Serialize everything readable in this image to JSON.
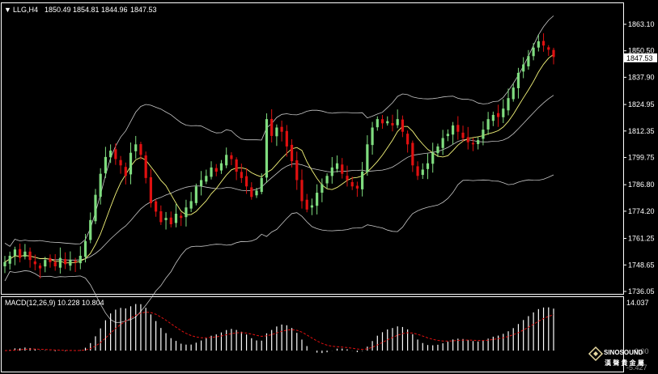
{
  "window": {
    "header_arrow": "▼",
    "symbol_label": "LLG,H4",
    "ohlc": [
      "1850.49",
      "1854.81",
      "1844.96",
      "1847.53"
    ]
  },
  "colors": {
    "background": "#000000",
    "bull_candle": "#7fdc7f",
    "bear_candle": "#e01010",
    "bollinger_band": "#c8c8c8",
    "moving_average": "#f5f57a",
    "macd_histogram": "#ffffff",
    "macd_signal": "#e01010",
    "frame": "#ffffff",
    "current_price_box": "#ffffff"
  },
  "price_axis": {
    "ticks": [
      "1863.10",
      "1850.50",
      "1837.90",
      "1824.95",
      "1812.35",
      "1799.75",
      "1786.80",
      "1774.20",
      "1761.25",
      "1748.65",
      "1736.05"
    ],
    "current_price": "1847.53"
  },
  "macd": {
    "label": "MACD(12,26,9) 10.228 10.804",
    "axis_max": "14.037",
    "axis_zero": "0.00",
    "axis_min": "-5.427"
  },
  "logo": {
    "name": "SINOSOUND",
    "subtitle": "漢 聲 貴 金 屬"
  },
  "chart_data": {
    "type": "candlestick",
    "title": "LLG,H4",
    "y_range": [
      1736.05,
      1866.0
    ],
    "ohlc_last": {
      "open": 1850.49,
      "high": 1854.81,
      "low": 1844.96,
      "close": 1847.53
    },
    "indicators": [
      "Bollinger Bands",
      "Moving Average",
      "MACD(12,26,9)"
    ],
    "macd": {
      "main": 10.228,
      "signal": 10.804,
      "range": [
        -5.427,
        14.037
      ]
    },
    "closes": [
      1750,
      1753,
      1756,
      1752,
      1755,
      1751,
      1749,
      1747,
      1751,
      1750,
      1748,
      1752,
      1749,
      1751,
      1750,
      1753,
      1760,
      1770,
      1782,
      1792,
      1800,
      1803,
      1799,
      1796,
      1791,
      1802,
      1806,
      1801,
      1790,
      1778,
      1774,
      1769,
      1771,
      1768,
      1773,
      1771,
      1776,
      1779,
      1786,
      1789,
      1791,
      1795,
      1793,
      1797,
      1801,
      1799,
      1793,
      1790,
      1786,
      1781,
      1784,
      1790,
      1818,
      1810,
      1814,
      1812,
      1805,
      1798,
      1789,
      1779,
      1775,
      1777,
      1783,
      1787,
      1791,
      1795,
      1797,
      1792,
      1789,
      1786,
      1785,
      1793,
      1806,
      1814,
      1818,
      1816,
      1817,
      1815,
      1818,
      1812,
      1806,
      1796,
      1791,
      1794,
      1797,
      1802,
      1805,
      1809,
      1811,
      1815,
      1812,
      1809,
      1807,
      1806,
      1808,
      1813,
      1818,
      1820,
      1819,
      1823,
      1828,
      1833,
      1840,
      1844,
      1848,
      1852,
      1855,
      1853,
      1851,
      1847.53
    ]
  }
}
